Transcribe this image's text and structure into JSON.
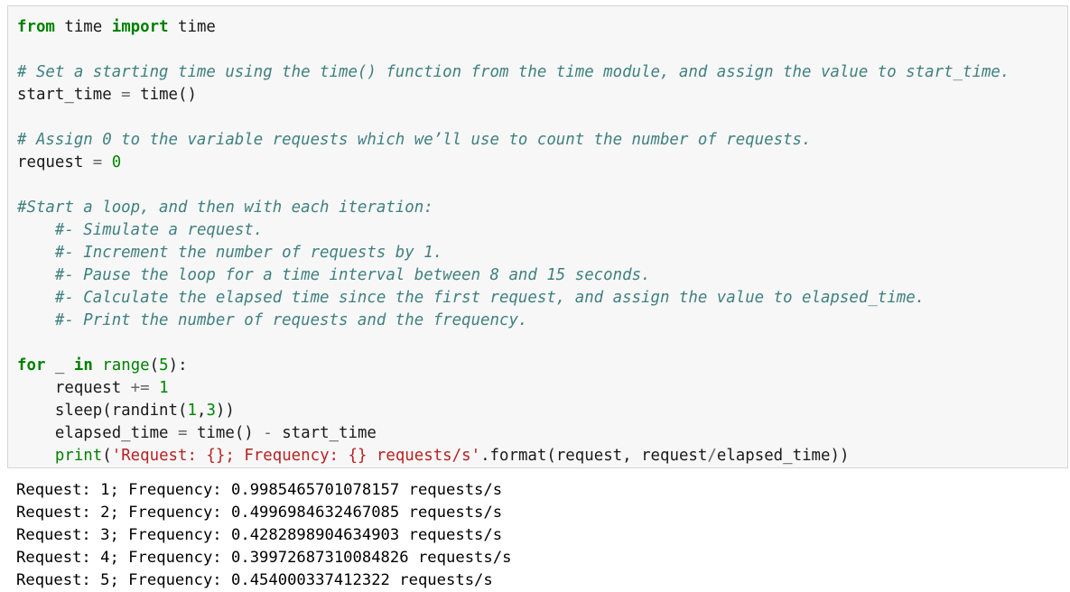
{
  "code_cell": {
    "lines": [
      [
        {
          "t": "from",
          "c": "kw"
        },
        {
          "t": " time ",
          "c": "plain"
        },
        {
          "t": "import",
          "c": "kw"
        },
        {
          "t": " time",
          "c": "plain"
        }
      ],
      [],
      [
        {
          "t": "# Set a starting time using the time() function from the time module, and assign the value to start_time.",
          "c": "cm"
        }
      ],
      [
        {
          "t": "start_time ",
          "c": "plain"
        },
        {
          "t": "=",
          "c": "op"
        },
        {
          "t": " time()",
          "c": "plain"
        }
      ],
      [],
      [
        {
          "t": "# Assign 0 to the variable requests which we’ll use to count the number of requests.",
          "c": "cm"
        }
      ],
      [
        {
          "t": "request ",
          "c": "plain"
        },
        {
          "t": "=",
          "c": "op"
        },
        {
          "t": " ",
          "c": "plain"
        },
        {
          "t": "0",
          "c": "nm"
        }
      ],
      [],
      [
        {
          "t": "#Start a loop, and then with each iteration:",
          "c": "cm"
        }
      ],
      [
        {
          "t": "    ",
          "c": "plain"
        },
        {
          "t": "#- Simulate a request.",
          "c": "cm"
        }
      ],
      [
        {
          "t": "    ",
          "c": "plain"
        },
        {
          "t": "#- Increment the number of requests by 1.",
          "c": "cm"
        }
      ],
      [
        {
          "t": "    ",
          "c": "plain"
        },
        {
          "t": "#- Pause the loop for a time interval between 8 and 15 seconds.",
          "c": "cm"
        }
      ],
      [
        {
          "t": "    ",
          "c": "plain"
        },
        {
          "t": "#- Calculate the elapsed time since the first request, and assign the value to elapsed_time.",
          "c": "cm"
        }
      ],
      [
        {
          "t": "    ",
          "c": "plain"
        },
        {
          "t": "#- Print the number of requests and the frequency.",
          "c": "cm"
        }
      ],
      [],
      [
        {
          "t": "for",
          "c": "kw"
        },
        {
          "t": " _ ",
          "c": "plain"
        },
        {
          "t": "in",
          "c": "kw"
        },
        {
          "t": " ",
          "c": "plain"
        },
        {
          "t": "range",
          "c": "bi"
        },
        {
          "t": "(",
          "c": "plain"
        },
        {
          "t": "5",
          "c": "nm"
        },
        {
          "t": "):",
          "c": "plain"
        }
      ],
      [
        {
          "t": "    request ",
          "c": "plain"
        },
        {
          "t": "+=",
          "c": "op"
        },
        {
          "t": " ",
          "c": "plain"
        },
        {
          "t": "1",
          "c": "nm"
        }
      ],
      [
        {
          "t": "    sleep(randint(",
          "c": "plain"
        },
        {
          "t": "1",
          "c": "nm"
        },
        {
          "t": ",",
          "c": "plain"
        },
        {
          "t": "3",
          "c": "nm"
        },
        {
          "t": "))",
          "c": "plain"
        }
      ],
      [
        {
          "t": "    elapsed_time ",
          "c": "plain"
        },
        {
          "t": "=",
          "c": "op"
        },
        {
          "t": " time() ",
          "c": "plain"
        },
        {
          "t": "-",
          "c": "op"
        },
        {
          "t": " start_time",
          "c": "plain"
        }
      ],
      [
        {
          "t": "    ",
          "c": "plain"
        },
        {
          "t": "print",
          "c": "bi"
        },
        {
          "t": "(",
          "c": "plain"
        },
        {
          "t": "'Request: {}; Frequency: {} requests/s'",
          "c": "st"
        },
        {
          "t": ".format(request, request",
          "c": "plain"
        },
        {
          "t": "/",
          "c": "op"
        },
        {
          "t": "elapsed_time))",
          "c": "plain"
        }
      ]
    ]
  },
  "output": {
    "lines": [
      "Request: 1; Frequency: 0.9985465701078157 requests/s",
      "Request: 2; Frequency: 0.4996984632467085 requests/s",
      "Request: 3; Frequency: 0.4282898904634903 requests/s",
      "Request: 4; Frequency: 0.39972687310084826 requests/s",
      "Request: 5; Frequency: 0.454000337412322 requests/s"
    ]
  }
}
